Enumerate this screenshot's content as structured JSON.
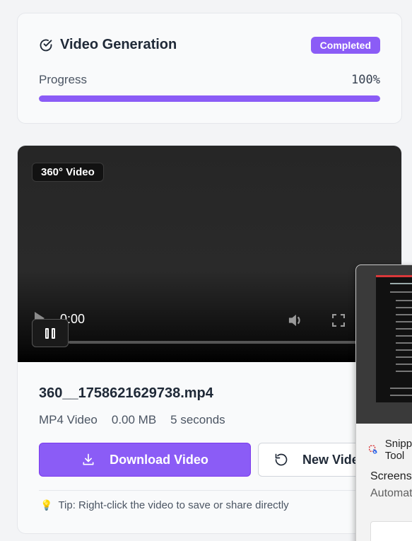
{
  "status": {
    "title": "Video Generation",
    "badge": "Completed",
    "progress_label": "Progress",
    "progress_text": "100%",
    "progress_fraction": 1.0,
    "accent_color": "#8b5cf6"
  },
  "video": {
    "tag": "360° Video",
    "current_time": "0:00",
    "file_name": "360__1758621629738.mp4",
    "meta": {
      "format": "MP4 Video",
      "size": "0.00 MB",
      "duration": "5 seconds"
    },
    "download_label": "Download Video",
    "new_video_label": "New Video",
    "tip_icon": "lightbulb-icon",
    "tip": "Tip: Right-click the video to save or share directly"
  },
  "snip_popup": {
    "app_name": "Snipping Tool",
    "title": "Screenshot copied to clipboard",
    "subtitle": "Automatically saved to screenshots folder"
  }
}
